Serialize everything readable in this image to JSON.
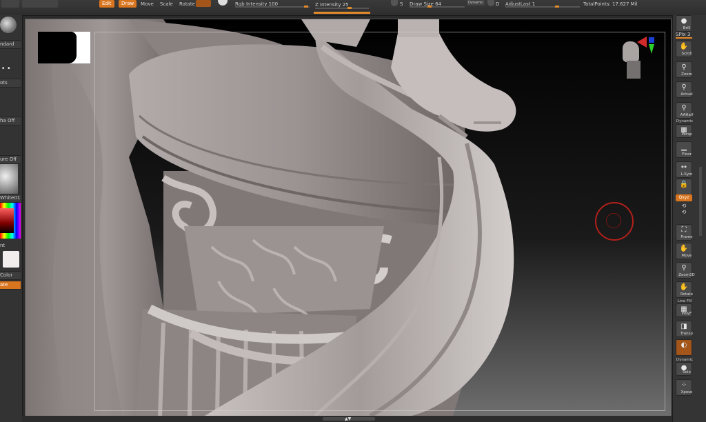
{
  "toolbar": {
    "edit_label": "Edit",
    "draw_label": "Draw",
    "move_label": "Move",
    "scale_label": "Scale",
    "rotate_label": "Rotate",
    "rgb_intensity": "Rgb Intensity 100",
    "z_intensity": "Z Intensity 25",
    "s_key": "S",
    "draw_size": "Draw Size 64",
    "dynamic_label": "Dynamic",
    "d_key": "D",
    "adjust_last": "AdjustLast 1",
    "total_points": "TotalPoints: 17.627 Mil"
  },
  "left_panel": {
    "standard": "ndard",
    "dots": "ots",
    "alpha_off": "ha Off",
    "texture_off": "ure Off",
    "material": "White01",
    "int": "nt",
    "color": "Color",
    "rotate": "ate"
  },
  "right_shelf": {
    "brill": "Brill",
    "spix": "SPix 3",
    "scroll": "Scroll",
    "zoom": "Zoom",
    "actual": "Actual",
    "aahalf": "AAHalf",
    "dynamic": "Dynamic",
    "persp": "Persp",
    "floor": "Floor",
    "lsym": "L.Sym",
    "gxyz": "Qxyz",
    "frame": "Frame",
    "move": "Move",
    "zoom3d": "Zoom3D",
    "rotate": "Rotate",
    "line_fill": "Line Fill",
    "polyf": "PolyF",
    "transp": "Transp",
    "dynamic2": "Dynamic",
    "solo": "Solo",
    "xpose": "Xpose"
  },
  "colors": {
    "accent": "#d9751f",
    "panel": "#333333",
    "viewport_bg": "#000000",
    "brush_ring": "#b3201a"
  }
}
